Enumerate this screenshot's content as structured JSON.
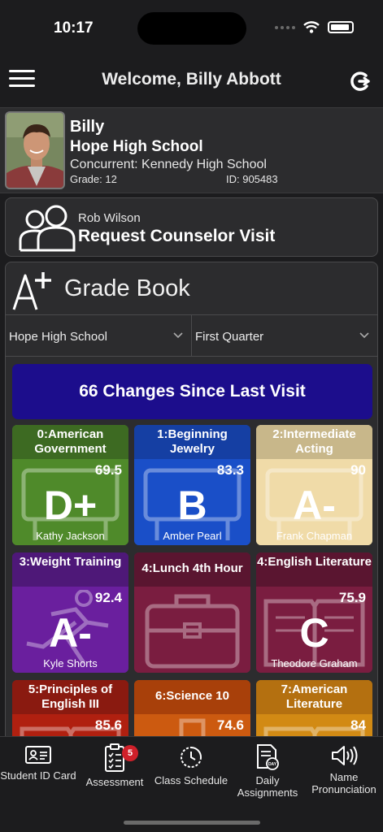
{
  "status": {
    "time": "10:17"
  },
  "nav": {
    "title": "Welcome, Billy Abbott",
    "menu_icon": "hamburger-icon",
    "refresh_icon": "refresh-icon"
  },
  "profile": {
    "name": "Billy",
    "school": "Hope High School",
    "concurrent": "Concurrent: Kennedy High School",
    "grade": "Grade: 12",
    "id": "ID: 905483"
  },
  "counselor": {
    "name": "Rob Wilson",
    "action": "Request Counselor Visit",
    "icon": "people-icon"
  },
  "gradebook": {
    "title": "Grade Book",
    "icon": "a-plus-icon",
    "school_select": "Hope High School",
    "term_select": "First Quarter",
    "changes": "66 Changes Since Last Visit",
    "classes": [
      {
        "title": "0:American Government",
        "pct": "69.5",
        "grade": "D+",
        "teacher": "Kathy Jackson",
        "head": "#3d6a22",
        "body": "#4f8a2a",
        "icon": "classroom-icon"
      },
      {
        "title": "1:Beginning Jewelry",
        "pct": "83.3",
        "grade": "B",
        "teacher": "Amber Pearl",
        "head": "#153fa3",
        "body": "#1a4fc8",
        "icon": "classroom-icon"
      },
      {
        "title": "2:Intermediate Acting",
        "pct": "90",
        "grade": "A-",
        "teacher": "Frank Chapman",
        "head": "#c8b78a",
        "body": "#f0dba8",
        "icon": "classroom-icon"
      },
      {
        "title": "3:Weight Training",
        "pct": "92.4",
        "grade": "A-",
        "teacher": "Kyle Shorts",
        "head": "#4e1878",
        "body": "#6a1f9e",
        "icon": "runner-icon"
      },
      {
        "title": "4:Lunch 4th Hour",
        "pct": "",
        "grade": "",
        "teacher": "",
        "head": "#5a1530",
        "body": "#7a1d40",
        "icon": "briefcase-icon"
      },
      {
        "title": "4:English Literature",
        "pct": "75.9",
        "grade": "C",
        "teacher": "Theodore Graham",
        "head": "#5a1530",
        "body": "#7a1d40",
        "icon": "book-icon"
      },
      {
        "title": "5:Principles of English III",
        "pct": "85.6",
        "grade": "",
        "teacher": "",
        "head": "#8a1a10",
        "body": "#b02010",
        "icon": "book-icon"
      },
      {
        "title": "6:Science 10",
        "pct": "74.6",
        "grade": "",
        "teacher": "",
        "head": "#a8400a",
        "body": "#cc5a10",
        "icon": "flask-icon"
      },
      {
        "title": "7:American Literature",
        "pct": "84",
        "grade": "",
        "teacher": "",
        "head": "#b47010",
        "body": "#d28a14",
        "icon": "book-icon"
      }
    ]
  },
  "tabs": [
    {
      "label": "Student ID Card",
      "icon": "id-card-icon"
    },
    {
      "label": "Assessment",
      "icon": "checklist-icon",
      "badge": "5"
    },
    {
      "label": "Class Schedule",
      "icon": "clock-icon"
    },
    {
      "label": "Daily Assignments",
      "icon": "calendar-day-icon"
    },
    {
      "label": "Name Pronunciation",
      "icon": "speaker-icon"
    }
  ]
}
